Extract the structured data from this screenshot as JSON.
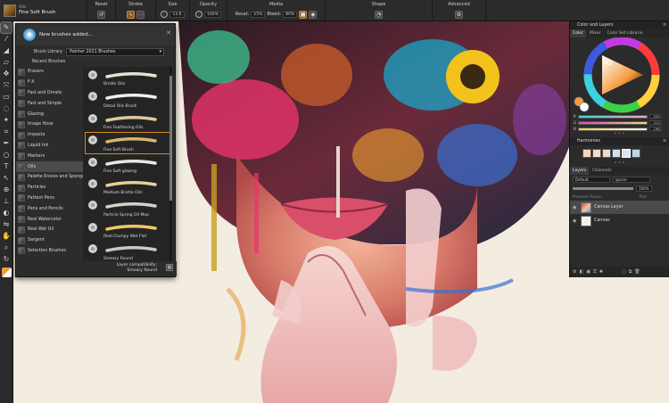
{
  "propbar": {
    "brush_variant_small": "Oils",
    "brush_variant_name": "Fine Soft Brush",
    "reset_label": "Reset",
    "stroke_label": "Stroke",
    "size_label": "Size",
    "size_value": "13.6",
    "opacity_label": "Opacity",
    "opacity_value": "100%",
    "media_label": "Media",
    "resat_label": "Resat:",
    "resat_value": "25%",
    "bleed_label": "Bleed:",
    "bleed_value": "80%",
    "shape_label": "Shape",
    "advanced_label": "Advanced"
  },
  "brushlib": {
    "notice": "New brushes added...",
    "library_label": "Brush Library",
    "library_value": "Painter 2021 Brushes",
    "recent_label": "Recent Brushes",
    "categories": [
      "Erasers",
      "F-X",
      "Fast and Ornate",
      "Fast and Simple",
      "Glazing",
      "Image Hose",
      "Impasto",
      "Liquid Ink",
      "Markers",
      "Oils",
      "Palette Knives and Sponges",
      "Particles",
      "Pattern Pens",
      "Pens and Pencils",
      "Real Watercolor",
      "Real Wet Oil",
      "Sargent",
      "Selection Brushes"
    ],
    "selected_category_index": 9,
    "variants": [
      "Bristle Oils",
      "Detail Oils Brush",
      "Fine Feathering Oils",
      "Fine Soft Brush",
      "Fine Soft glazing",
      "Medium Bristle Oils",
      "Particle Spring Oil Mop",
      "Real Clumpy Wet Flat",
      "Smeary Round"
    ],
    "selected_variant_index": 3,
    "footer_line1": "Layer compatibility:",
    "footer_line2": "Smeary Round",
    "accent_color": "#d58a1c"
  },
  "colorpanel": {
    "title": "Color and Layers",
    "tabs": [
      "Color",
      "Mixer",
      "Color Set Librarie"
    ],
    "r_value": "254",
    "g_value": "222",
    "b_value": "196",
    "main_color": "#f59a38"
  },
  "harmonies": {
    "title": "Harmonies",
    "swatches": [
      "#f4d6c0",
      "#f6dccb",
      "#e9dcd2",
      "#cfe2ec",
      "#d7e6f0",
      "#bcd6e6"
    ]
  },
  "layers": {
    "tabs": [
      "Layers",
      "Channels"
    ],
    "composite_method": "Default",
    "composite_depth": "Ignore",
    "opacity_value": "100%",
    "preserve_label": "Preserve Transp.",
    "pick_label": "Pick",
    "items": [
      {
        "name": "Canvas Layer"
      },
      {
        "name": "Canvas"
      }
    ],
    "selected_index": 0
  }
}
